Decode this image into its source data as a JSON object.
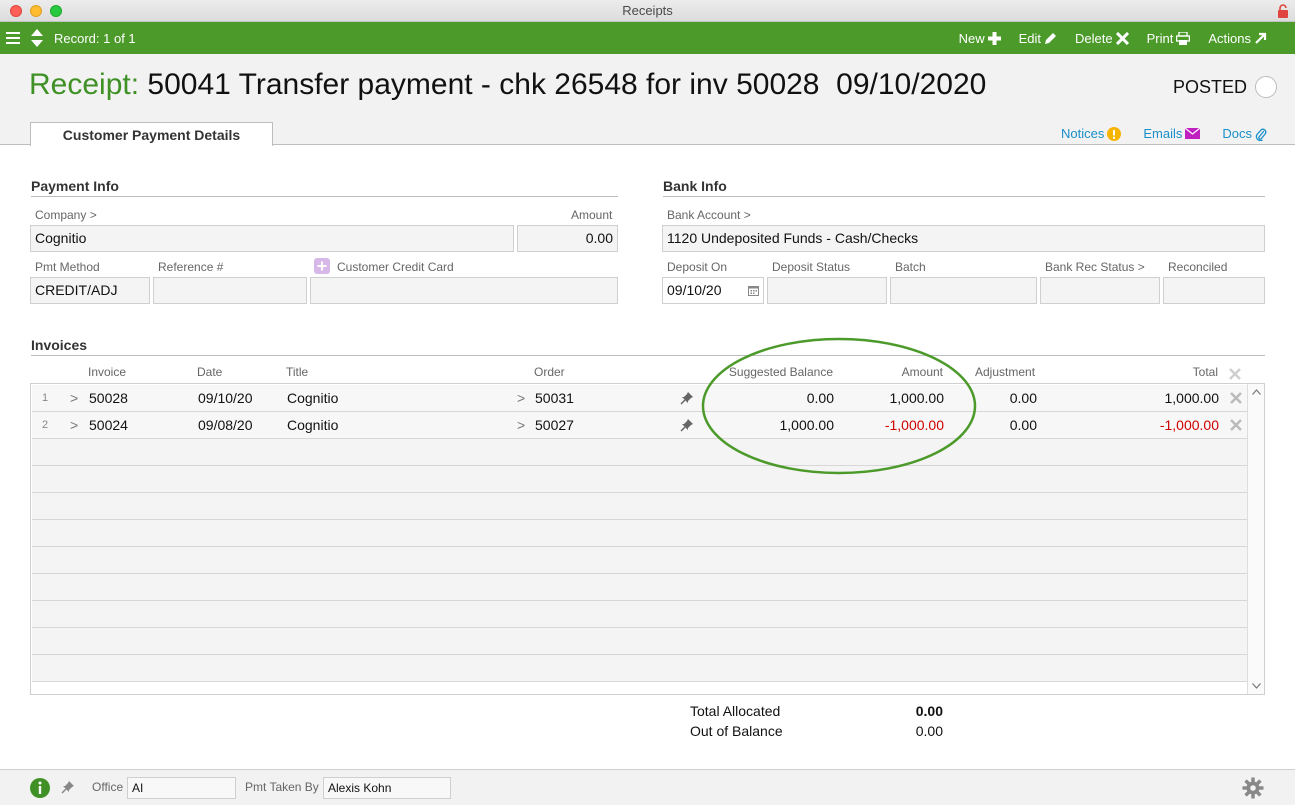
{
  "window": {
    "title": "Receipts"
  },
  "toolbar": {
    "record": "Record: 1 of 1",
    "new_label": "New",
    "edit_label": "Edit",
    "delete_label": "Delete",
    "print_label": "Print",
    "actions_label": "Actions"
  },
  "header": {
    "label": "Receipt:",
    "title": "50041 Transfer payment - chk 26548 for inv 50028  09/10/2020",
    "status": "POSTED",
    "tab": "Customer Payment Details",
    "links": {
      "notices": "Notices",
      "emails": "Emails",
      "docs": "Docs"
    }
  },
  "payment_info": {
    "section": "Payment Info",
    "company_label": "Company >",
    "company": "Cognitio",
    "amount_label": "Amount",
    "amount": "0.00",
    "pmt_method_label": "Pmt Method",
    "pmt_method": "CREDIT/ADJ",
    "reference_label": "Reference #",
    "reference": "",
    "credit_card_label": "Customer Credit Card",
    "credit_card": ""
  },
  "bank_info": {
    "section": "Bank Info",
    "bank_account_label": "Bank Account >",
    "bank_account": "1120 Undeposited Funds - Cash/Checks",
    "deposit_on_label": "Deposit On",
    "deposit_on": "09/10/20",
    "deposit_status_label": "Deposit Status",
    "batch_label": "Batch",
    "bank_rec_status_label": "Bank Rec Status >",
    "reconciled_label": "Reconciled"
  },
  "invoices": {
    "section": "Invoices",
    "columns": {
      "invoice": "Invoice",
      "date": "Date",
      "title": "Title",
      "order": "Order",
      "suggested": "Suggested Balance",
      "amount": "Amount",
      "adjustment": "Adjustment",
      "total": "Total"
    },
    "rows": [
      {
        "num": "1",
        "invoice": "50028",
        "date": "09/10/20",
        "title": "Cognitio",
        "order": "50031",
        "suggested": "0.00",
        "amount": "1,000.00",
        "adjustment": "0.00",
        "total": "1,000.00"
      },
      {
        "num": "2",
        "invoice": "50024",
        "date": "09/08/20",
        "title": "Cognitio",
        "order": "50027",
        "suggested": "1,000.00",
        "amount": "-1,000.00",
        "adjustment": "0.00",
        "total": "-1,000.00"
      }
    ],
    "chevron": ">"
  },
  "totals": {
    "allocated_label": "Total Allocated",
    "allocated": "0.00",
    "balance_label": "Out of Balance",
    "balance": "0.00"
  },
  "footer": {
    "office_label": "Office",
    "office": "AI",
    "taken_by_label": "Pmt Taken By",
    "taken_by": "Alexis Kohn"
  },
  "colors": {
    "toolbar": "#4c9a2a",
    "accent": "#3f9126",
    "link": "#1a8fc9",
    "negative": "#d00000",
    "annotation": "#4c9a2a"
  }
}
